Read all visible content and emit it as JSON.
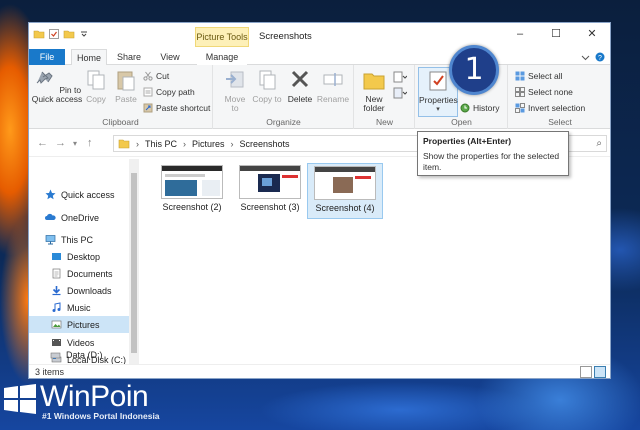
{
  "window": {
    "context_tab": "Picture Tools",
    "title": "Screenshots",
    "controls": {
      "minimize": "–",
      "maximize": "☐",
      "close": "✕"
    }
  },
  "tabs": {
    "file": "File",
    "home": "Home",
    "share": "Share",
    "view": "View",
    "manage": "Manage"
  },
  "ribbon": {
    "clipboard": {
      "label": "Clipboard",
      "pin": "Pin to Quick access",
      "copy": "Copy",
      "paste": "Paste",
      "cut": "Cut",
      "copy_path": "Copy path",
      "paste_shortcut": "Paste shortcut"
    },
    "organize": {
      "label": "Organize",
      "move_to": "Move to",
      "copy_to": "Copy to",
      "delete": "Delete",
      "rename": "Rename"
    },
    "new": {
      "label": "New",
      "new_folder": "New folder"
    },
    "open": {
      "label": "Open",
      "properties": "Properties",
      "history": "History"
    },
    "select": {
      "label": "Select",
      "select_all": "Select all",
      "select_none": "Select none",
      "invert": "Invert selection"
    }
  },
  "address": {
    "crumbs": [
      "This PC",
      "Pictures",
      "Screenshots"
    ],
    "search_icon": "⌕"
  },
  "nav": {
    "items": [
      {
        "label": "Quick access",
        "icon": "star-icon"
      },
      {
        "label": "OneDrive",
        "icon": "cloud-icon"
      },
      {
        "label": "This PC",
        "icon": "computer-icon"
      },
      {
        "label": "Desktop",
        "icon": "folder-icon"
      },
      {
        "label": "Documents",
        "icon": "folder-icon"
      },
      {
        "label": "Downloads",
        "icon": "download-icon"
      },
      {
        "label": "Music",
        "icon": "music-icon"
      },
      {
        "label": "Pictures",
        "icon": "folder-icon"
      },
      {
        "label": "Videos",
        "icon": "folder-icon"
      },
      {
        "label": "Local Disk (C:)",
        "icon": "drive-icon"
      },
      {
        "label": "Data (D:)",
        "icon": "drive-icon"
      }
    ]
  },
  "files": [
    {
      "name": "Screenshot (2)"
    },
    {
      "name": "Screenshot (3)"
    },
    {
      "name": "Screenshot (4)"
    }
  ],
  "status": {
    "count": "3 items"
  },
  "tooltip": {
    "title": "Properties (Alt+Enter)",
    "body": "Show the properties for the selected item."
  },
  "badge": {
    "number": "1"
  },
  "branding": {
    "name": "WinPoin",
    "tagline": "#1 Windows Portal Indonesia"
  },
  "colors": {
    "file_tab": "#1979ca",
    "selection": "#cce4f7",
    "badge": "#1f3f8a"
  }
}
